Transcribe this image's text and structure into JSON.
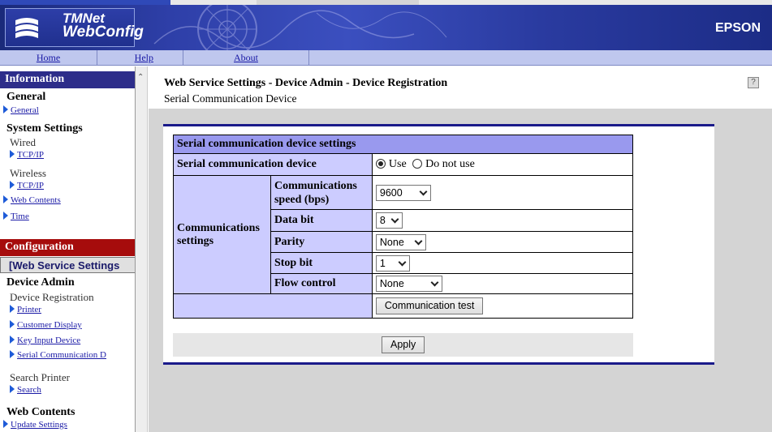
{
  "brand": {
    "product_line1": "TMNet",
    "product_line2": "WebConfig",
    "vendor": "EPSON"
  },
  "menu": {
    "home": "Home",
    "help": "Help",
    "about": "About"
  },
  "sidebar": {
    "information": {
      "title": "Information",
      "general_cat": "General",
      "general_link": "General",
      "system_cat": "System Settings",
      "wired": "Wired",
      "wired_tcpip": "TCP/IP",
      "wireless": "Wireless",
      "wireless_tcpip": "TCP/IP",
      "web_contents": "Web Contents",
      "time": "Time"
    },
    "configuration": {
      "title": "Configuration",
      "selected": "[Web Service Settings",
      "device_admin": "Device Admin",
      "device_registration": "Device Registration",
      "printer": "Printer",
      "customer_display": "Customer Display",
      "key_input_device": "Key Input Device",
      "serial_comm": "Serial Communication D",
      "search_printer": "Search Printer",
      "search": "Search",
      "web_contents_cat": "Web Contents",
      "update_settings": "Update Settings"
    }
  },
  "page": {
    "title": "Web Service Settings - Device Admin - Device Registration",
    "subtitle": "Serial Communication Device",
    "help_icon": "?"
  },
  "settings": {
    "header": "Serial communication device settings",
    "device_label": "Serial communication device",
    "use_label": "Use",
    "do_not_use_label": "Do not use",
    "use_selected": true,
    "comm_group_label": "Communications settings",
    "speed_label": "Communications speed (bps)",
    "speed_value": "9600",
    "databit_label": "Data bit",
    "databit_value": "8",
    "parity_label": "Parity",
    "parity_value": "None",
    "stopbit_label": "Stop bit",
    "stopbit_value": "1",
    "flow_label": "Flow control",
    "flow_value": "None",
    "comm_test_button": "Communication test",
    "apply_button": "Apply"
  },
  "colors": {
    "banner": "#2e3fa8",
    "info_header": "#2d2d8a",
    "config_header": "#a60c0c",
    "table_header": "#9999ee",
    "table_label": "#ccccff"
  }
}
